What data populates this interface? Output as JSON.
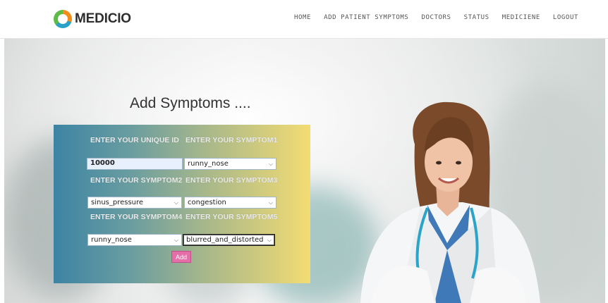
{
  "brand": {
    "name": "MEDICIO"
  },
  "nav": {
    "items": [
      "HOME",
      "ADD PATIENT SYMPTOMS",
      "DOCTORS",
      "STATUS",
      "MEDICIENE",
      "LOGOUT"
    ]
  },
  "hero": {
    "title": "Add Symptoms ...."
  },
  "form": {
    "label_unique_id": "ENTER YOUR UNIQUE ID",
    "label_symptom1": "ENTER YOUR SYMPTOM1",
    "label_symptom2": "ENTER YOUR SYMPTOM2",
    "label_symptom3": "ENTER YOUR SYMPTOM3",
    "label_symptom4": "ENTER YOUR SYMPTOM4",
    "label_symptom5": "ENTER YOUR SYMPTOM5",
    "unique_id_value": "10000",
    "symptom1_value": "runny_nose",
    "symptom2_value": "sinus_pressure",
    "symptom3_value": "congestion",
    "symptom4_value": "runny_nose",
    "symptom5_value": "blurred_and_distorted",
    "add_label": "Add"
  },
  "colors": {
    "form_gradient_start": "#3c84a4",
    "form_gradient_end": "#f3dc73",
    "add_button": "#e46fa8",
    "uniform_white": "#ffffff",
    "scrubs_blue": "#3f79b8",
    "stethoscope_teal": "#2aa5c9"
  },
  "icons": {
    "logo": "medicio-ring-logo",
    "dropdown": "chevron-down-icon"
  }
}
